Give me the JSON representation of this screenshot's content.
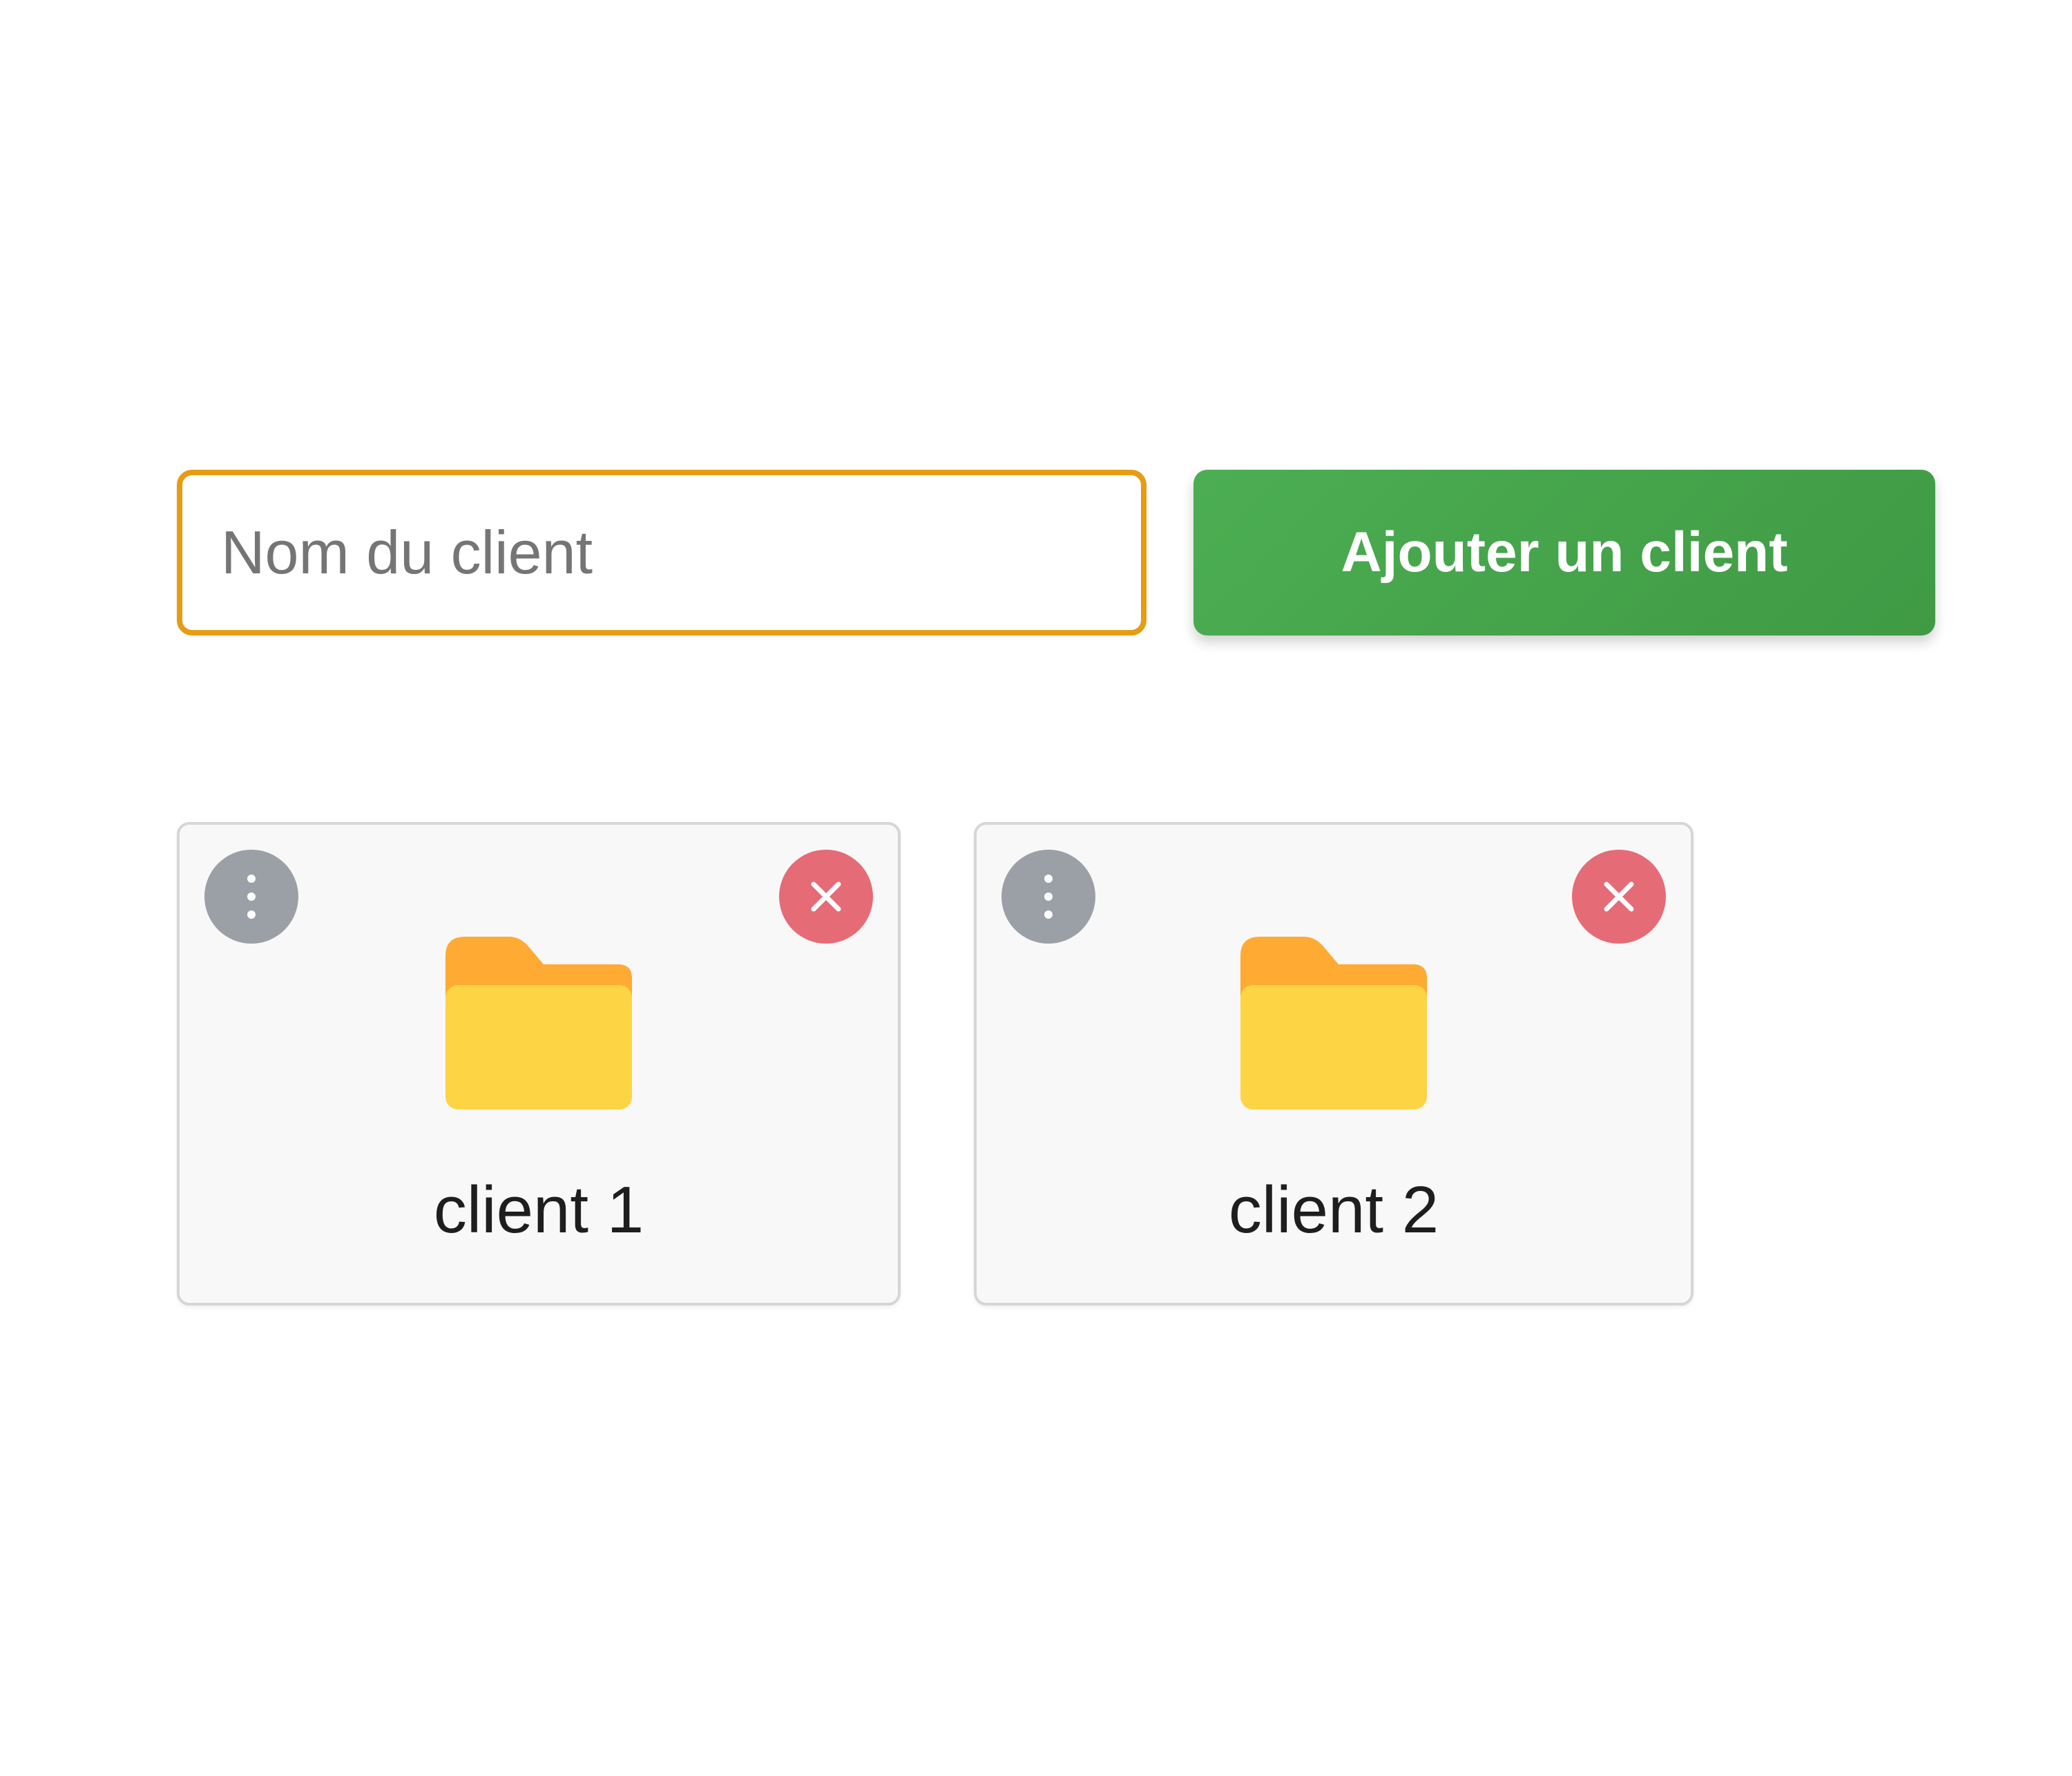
{
  "form": {
    "input_placeholder": "Nom du client",
    "input_value": "",
    "add_button_label": "Ajouter un client"
  },
  "clients": [
    {
      "name": "client 1"
    },
    {
      "name": "client 2"
    }
  ],
  "icons": {
    "menu": "more-vertical-icon",
    "delete": "close-icon",
    "folder": "folder-icon"
  },
  "colors": {
    "input_border": "#e69c13",
    "add_button": "#4caf50",
    "menu_button": "#9aa0a6",
    "delete_button": "#e56b77",
    "folder_tab": "#ffaa33",
    "folder_body": "#fdd444",
    "card_background": "#f8f8f8"
  }
}
